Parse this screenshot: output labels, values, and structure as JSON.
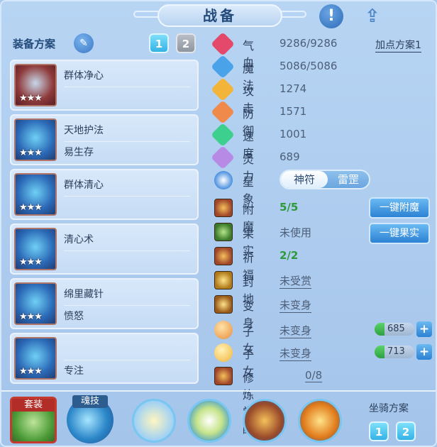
{
  "header": {
    "title": "战备"
  },
  "left": {
    "scheme_label": "装备方案",
    "scheme_buttons": [
      "1",
      "2"
    ],
    "equipment": [
      {
        "line1": "群体净心",
        "line2": "",
        "stars": "★★★"
      },
      {
        "line1": "天地护法",
        "line2": "易生存",
        "stars": "★★★"
      },
      {
        "line1": "群体清心",
        "line2": "",
        "stars": "★★★"
      },
      {
        "line1": "清心术",
        "line2": "",
        "stars": "★★★"
      },
      {
        "line1": "绵里藏针",
        "line2": "愤怒",
        "stars": "★★★"
      },
      {
        "line1": "",
        "line2": "专注",
        "stars": "★★★"
      }
    ]
  },
  "stats": {
    "add_point_scheme": "加点方案1",
    "rows": [
      {
        "label": "气血",
        "value": "9286/9286",
        "color": "#e4486a"
      },
      {
        "label": "魔法",
        "value": "5086/5086",
        "color": "#4aa3e8"
      },
      {
        "label": "攻击",
        "value": "1274",
        "color": "#f3b43a"
      },
      {
        "label": "防御",
        "value": "1571",
        "color": "#f08a4b"
      },
      {
        "label": "速度",
        "value": "1001",
        "color": "#3ccf8e"
      },
      {
        "label": "灵力",
        "value": "689",
        "color": "#b78ae6"
      }
    ],
    "xingxiang": {
      "label": "星象",
      "option_on": "神符",
      "option_off": "雷罡"
    }
  },
  "extras": [
    {
      "label": "附魔",
      "value": "5/5"
    },
    {
      "label": "果实",
      "value": "未使用"
    },
    {
      "label": "祈福",
      "value": "2/2"
    },
    {
      "label": "封地",
      "value": "未受赏"
    },
    {
      "label": "变身",
      "value": "未变身"
    },
    {
      "label": "子女",
      "value": "未变身",
      "bar": "685"
    },
    {
      "label": "子女",
      "value": "未变身",
      "bar": "713"
    },
    {
      "label": "修炼觉醒",
      "value": "0/8"
    }
  ],
  "actions": {
    "enchant": "一键附魔",
    "fruit": "一键果实",
    "plus": "+"
  },
  "bottom": {
    "taozhuang": "套装",
    "hunji": "魂技",
    "mount_scheme_label": "坐骑方案",
    "mount_buttons": [
      "1",
      "2"
    ]
  }
}
